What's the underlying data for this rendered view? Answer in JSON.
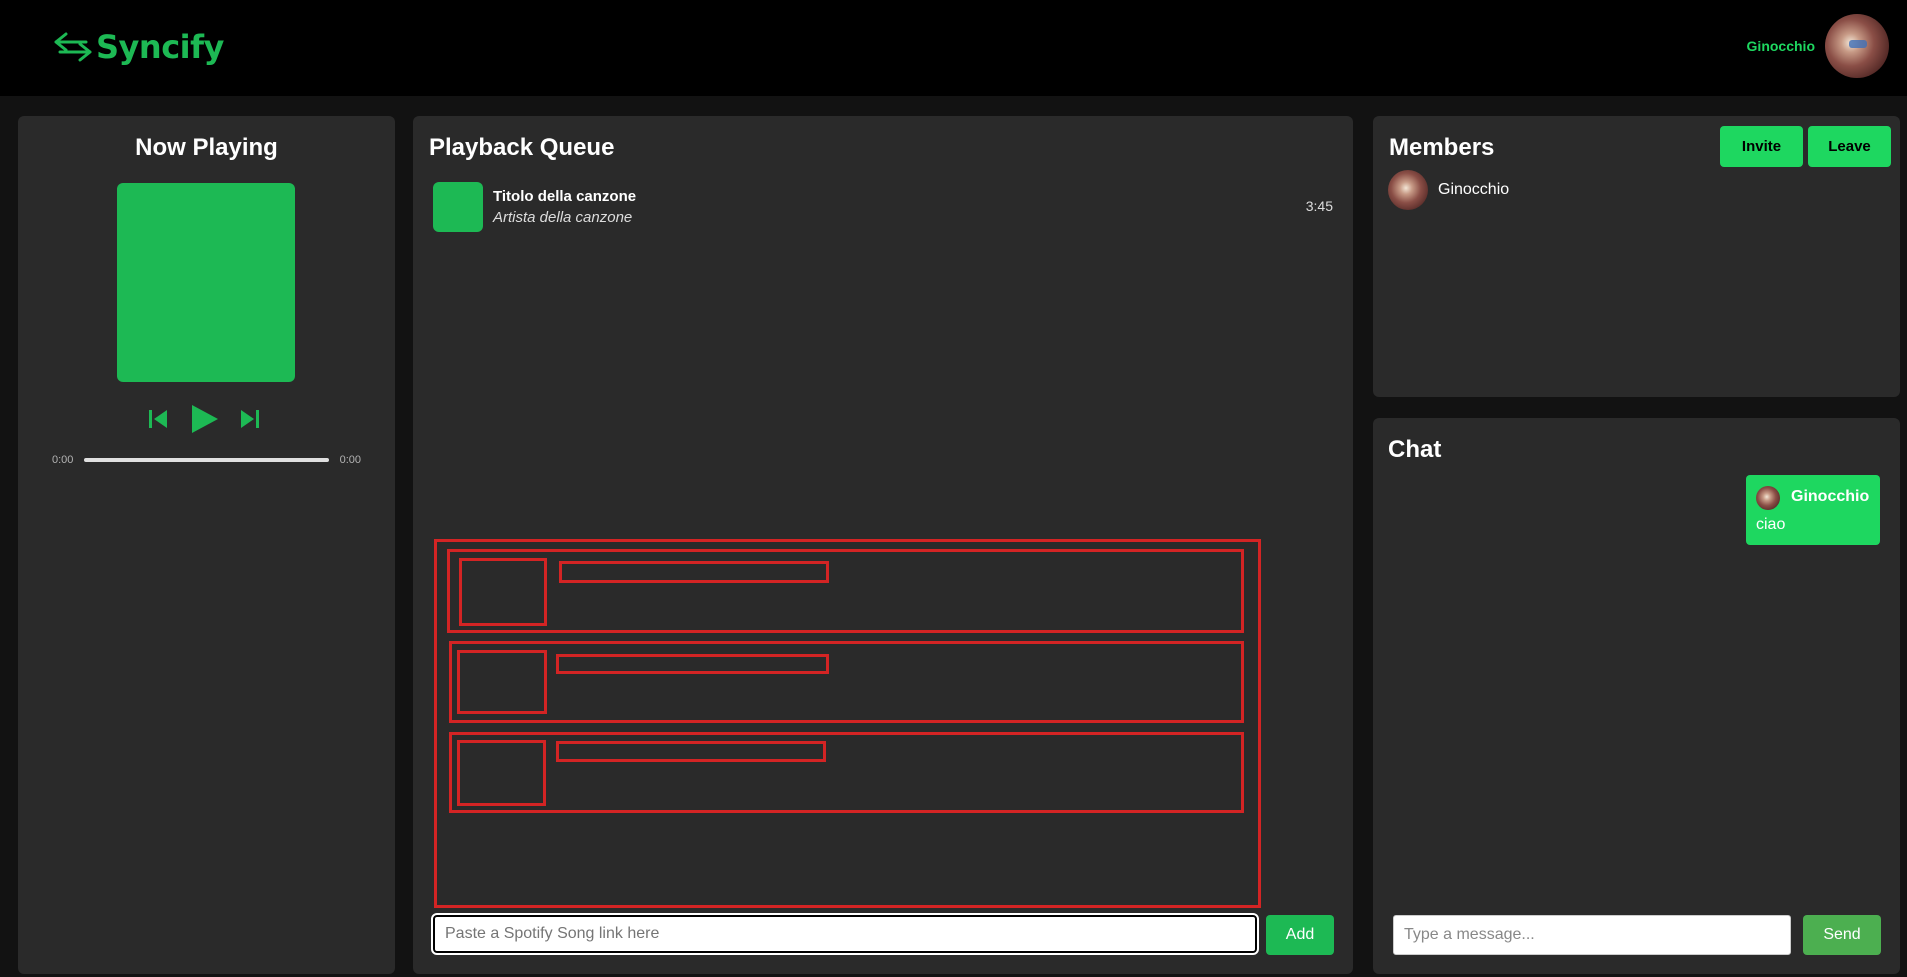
{
  "header": {
    "app_name": "Syncify",
    "logo_icon": "swap-arrows-icon",
    "username": "Ginocchio",
    "avatar_icon": "user-avatar"
  },
  "now_playing": {
    "title": "Now Playing",
    "controls": [
      "previous-icon",
      "play-icon",
      "next-icon"
    ],
    "current_time": "0:00",
    "total_time": "0:00",
    "progress": 0
  },
  "queue": {
    "title": "Playback Queue",
    "items": [
      {
        "title": "Titolo della canzone",
        "artist": "Artista della canzone",
        "duration": "3:45"
      }
    ],
    "input_placeholder": "Paste a Spotify Song link here",
    "add_label": "Add"
  },
  "members": {
    "title": "Members",
    "invite_label": "Invite",
    "leave_label": "Leave",
    "list": [
      {
        "name": "Ginocchio"
      }
    ]
  },
  "chat": {
    "title": "Chat",
    "messages": [
      {
        "sender": "Ginocchio",
        "text": "ciao"
      }
    ],
    "input_placeholder": "Type a message...",
    "send_label": "Send"
  },
  "colors": {
    "accent": "#1db954",
    "accent_bright": "#1ed760",
    "panel": "#2a2a2a",
    "background": "#121212",
    "wireframe": "#d32424"
  }
}
